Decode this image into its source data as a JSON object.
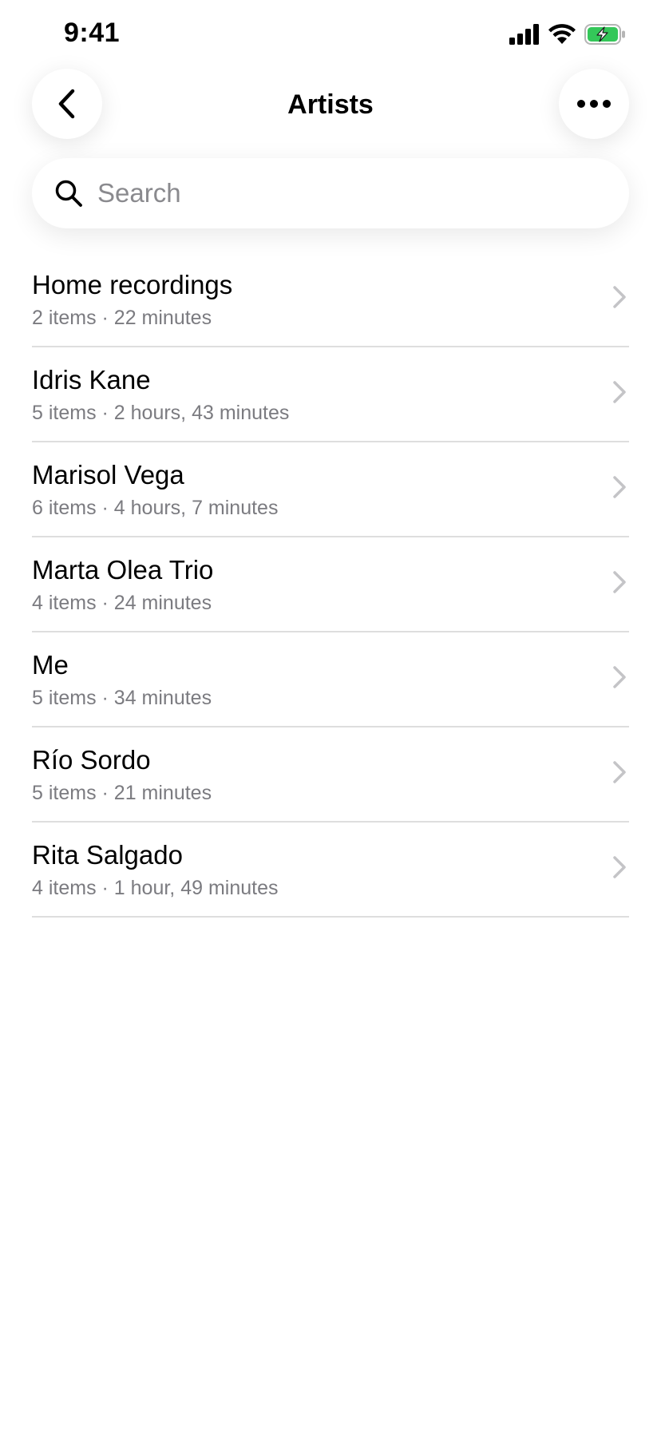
{
  "status_bar": {
    "time": "9:41",
    "icons": [
      "cellular-signal-icon",
      "wifi-icon",
      "battery-charging-icon"
    ],
    "battery_color": "#34c759"
  },
  "nav": {
    "title": "Artists",
    "back_icon": "chevron-left-icon",
    "more_icon": "ellipsis-icon"
  },
  "search": {
    "placeholder": "Search",
    "value": "",
    "icon": "search-icon"
  },
  "artists": [
    {
      "name": "Home recordings",
      "details": "2 items · 22 minutes"
    },
    {
      "name": "Idris Kane",
      "details": "5 items · 2 hours, 43 minutes"
    },
    {
      "name": "Marisol Vega",
      "details": "6 items · 4 hours, 7 minutes"
    },
    {
      "name": "Marta Olea Trio",
      "details": "4 items · 24 minutes"
    },
    {
      "name": "Me",
      "details": "5 items · 34 minutes"
    },
    {
      "name": "Río Sordo",
      "details": "5 items · 21 minutes"
    },
    {
      "name": "Rita Salgado",
      "details": "4 items · 1 hour, 49 minutes"
    }
  ],
  "colors": {
    "text_primary": "#000000",
    "text_secondary": "#7b7b80",
    "divider": "#dedede",
    "chevron": "#c4c4c7"
  }
}
